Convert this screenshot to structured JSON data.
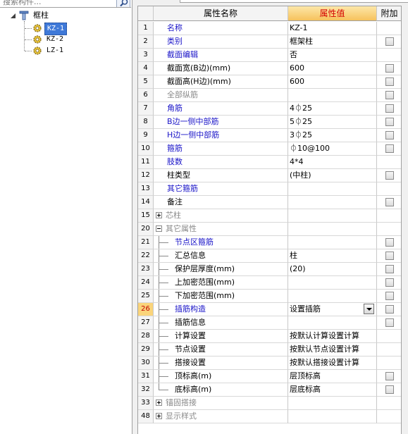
{
  "search": {
    "placeholder": "搜索构件..."
  },
  "tree": {
    "root": {
      "label": "框柱"
    },
    "children": [
      {
        "label": "KZ-1",
        "selected": true
      },
      {
        "label": "KZ-2",
        "selected": false
      },
      {
        "label": "LZ-1",
        "selected": false
      }
    ]
  },
  "grid": {
    "headers": {
      "name": "属性名称",
      "value": "属性值",
      "add": "附加"
    },
    "rows": [
      {
        "num": "1",
        "name": "名称",
        "value": "KZ-1",
        "color": "blue",
        "indent": 0,
        "checkbox": false
      },
      {
        "num": "2",
        "name": "类别",
        "value": "框架柱",
        "color": "blue",
        "indent": 0,
        "checkbox": true
      },
      {
        "num": "3",
        "name": "截面编辑",
        "value": "否",
        "color": "blue",
        "indent": 0,
        "checkbox": false
      },
      {
        "num": "4",
        "name": "截面宽(B边)(mm)",
        "value": "600",
        "color": "black",
        "indent": 0,
        "checkbox": true
      },
      {
        "num": "5",
        "name": "截面高(H边)(mm)",
        "value": "600",
        "color": "black",
        "indent": 0,
        "checkbox": true
      },
      {
        "num": "6",
        "name": "全部纵筋",
        "value": "",
        "color": "gray",
        "indent": 0,
        "checkbox": true
      },
      {
        "num": "7",
        "name": "角筋",
        "value": "4⏀25",
        "color": "blue",
        "indent": 0,
        "checkbox": true
      },
      {
        "num": "8",
        "name": "B边一侧中部筋",
        "value": "5⏀25",
        "color": "blue",
        "indent": 0,
        "checkbox": true
      },
      {
        "num": "9",
        "name": "H边一侧中部筋",
        "value": "3⏀25",
        "color": "blue",
        "indent": 0,
        "checkbox": true
      },
      {
        "num": "10",
        "name": "箍筋",
        "value": "⏀10@100",
        "color": "blue",
        "indent": 0,
        "checkbox": true
      },
      {
        "num": "11",
        "name": "肢数",
        "value": "4*4",
        "color": "blue",
        "indent": 0,
        "checkbox": false
      },
      {
        "num": "12",
        "name": "柱类型",
        "value": "(中柱)",
        "color": "black",
        "indent": 0,
        "checkbox": true
      },
      {
        "num": "13",
        "name": "其它箍筋",
        "value": "",
        "color": "blue",
        "indent": 0,
        "checkbox": false
      },
      {
        "num": "14",
        "name": "备注",
        "value": "",
        "color": "black",
        "indent": 0,
        "checkbox": true
      },
      {
        "num": "15",
        "name": "芯柱",
        "value": "",
        "color": "gray",
        "group": "plus",
        "checkbox": false
      },
      {
        "num": "20",
        "name": "其它属性",
        "value": "",
        "color": "gray",
        "group": "minus",
        "checkbox": false
      },
      {
        "num": "21",
        "name": "节点区箍筋",
        "value": "",
        "color": "blue",
        "child": true,
        "checkbox": true
      },
      {
        "num": "22",
        "name": "汇总信息",
        "value": "柱",
        "color": "black",
        "child": true,
        "checkbox": true
      },
      {
        "num": "23",
        "name": "保护层厚度(mm)",
        "value": "(20)",
        "color": "black",
        "child": true,
        "checkbox": true
      },
      {
        "num": "24",
        "name": "上加密范围(mm)",
        "value": "",
        "color": "black",
        "child": true,
        "checkbox": true
      },
      {
        "num": "25",
        "name": "下加密范围(mm)",
        "value": "",
        "color": "black",
        "child": true,
        "checkbox": true
      },
      {
        "num": "26",
        "name": "插筋构造",
        "value": "设置插筋",
        "color": "blue",
        "child": true,
        "checkbox": true,
        "selected": true
      },
      {
        "num": "27",
        "name": "插筋信息",
        "value": "",
        "color": "black",
        "child": true,
        "checkbox": true
      },
      {
        "num": "28",
        "name": "计算设置",
        "value": "按默认计算设置计算",
        "color": "black",
        "child": true,
        "checkbox": false
      },
      {
        "num": "29",
        "name": "节点设置",
        "value": "按默认节点设置计算",
        "color": "black",
        "child": true,
        "checkbox": false
      },
      {
        "num": "30",
        "name": "搭接设置",
        "value": "按默认搭接设置计算",
        "color": "black",
        "child": true,
        "checkbox": false
      },
      {
        "num": "31",
        "name": "顶标高(m)",
        "value": "层顶标高",
        "color": "black",
        "child": true,
        "checkbox": true
      },
      {
        "num": "32",
        "name": "底标高(m)",
        "value": "层底标高",
        "color": "black",
        "child": true,
        "checkbox": true,
        "last": true
      },
      {
        "num": "33",
        "name": "锚固搭接",
        "value": "",
        "color": "gray",
        "group": "plus",
        "checkbox": false
      },
      {
        "num": "48",
        "name": "显示样式",
        "value": "",
        "color": "gray",
        "group": "plus",
        "checkbox": false
      }
    ]
  },
  "colors": {
    "selection": "#3f79d8",
    "header_value": "#f6c25c",
    "blue_text": "#1a14c8"
  },
  "icons": {
    "search": "magnifier-icon",
    "folder": "column-type-icon",
    "node": "gear-component-icon"
  }
}
